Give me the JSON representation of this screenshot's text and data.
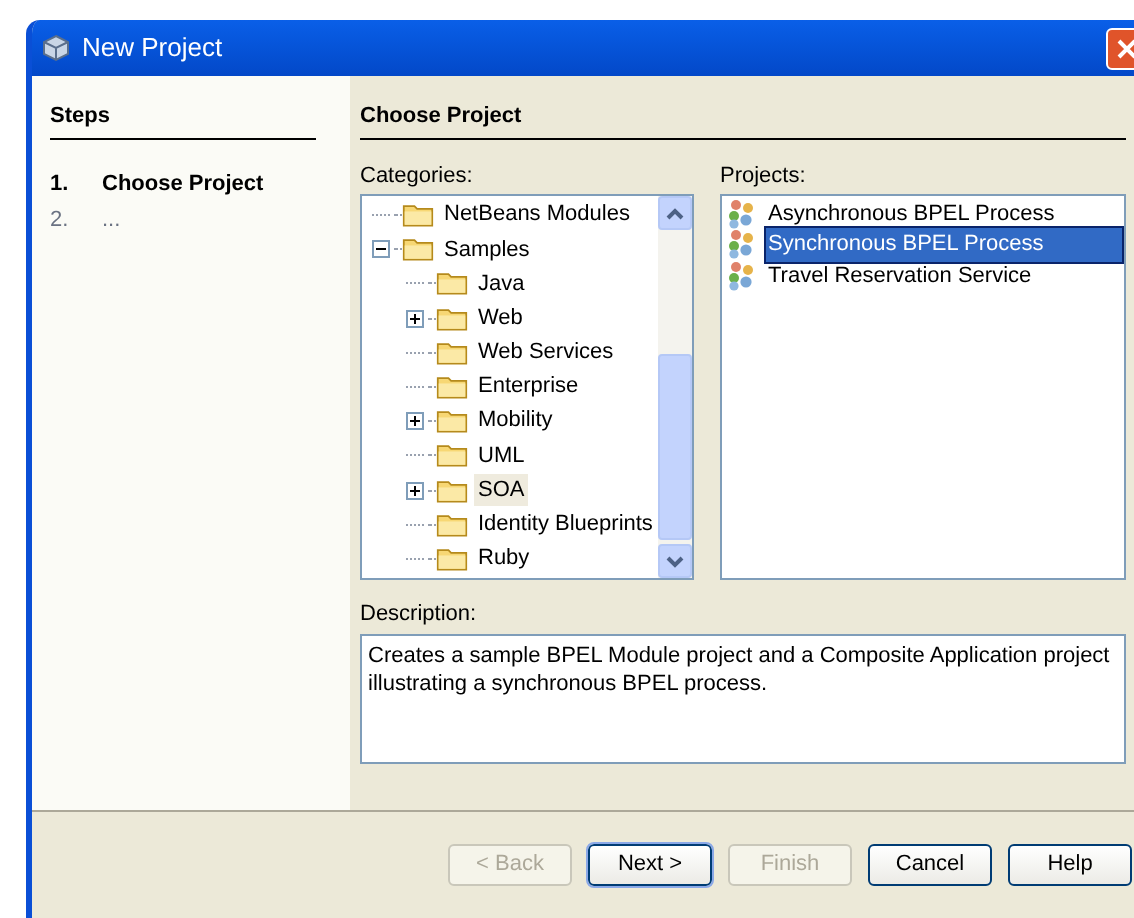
{
  "window": {
    "title": "New Project"
  },
  "steps": {
    "title": "Steps",
    "items": [
      {
        "number": "1.",
        "label": "Choose Project",
        "selected": true
      },
      {
        "number": "2.",
        "label": "...",
        "selected": false
      }
    ]
  },
  "panel": {
    "title": "Choose Project"
  },
  "categories": {
    "label": "Categories:",
    "items": [
      {
        "label": "NetBeans Modules",
        "selected": false
      },
      {
        "label": "Samples",
        "expanded": true,
        "selected": false,
        "children": [
          {
            "label": "Java",
            "selected": false
          },
          {
            "label": "Web",
            "expanded": false,
            "selected": false
          },
          {
            "label": "Web Services",
            "selected": false
          },
          {
            "label": "Enterprise",
            "selected": false
          },
          {
            "label": "Mobility",
            "expanded": false,
            "selected": false
          },
          {
            "label": "UML",
            "selected": false
          },
          {
            "label": "SOA",
            "expanded": false,
            "selected": true
          },
          {
            "label": "Identity Blueprints",
            "selected": false
          },
          {
            "label": "Ruby",
            "selected": false
          }
        ]
      }
    ]
  },
  "projects": {
    "label": "Projects:",
    "items": [
      {
        "label": "Asynchronous BPEL Process",
        "selected": false
      },
      {
        "label": "Synchronous BPEL Process",
        "selected": true
      },
      {
        "label": "Travel Reservation Service",
        "selected": false
      }
    ]
  },
  "description": {
    "label": "Description:",
    "text": "Creates a sample BPEL Module project and a Composite Application project illustrating a synchronous BPEL process."
  },
  "buttons": [
    {
      "label": "< Back",
      "disabled": true,
      "default": false
    },
    {
      "label": "Next >",
      "disabled": false,
      "default": true
    },
    {
      "label": "Finish",
      "disabled": true,
      "default": false
    },
    {
      "label": "Cancel",
      "disabled": false,
      "default": false
    },
    {
      "label": "Help",
      "disabled": false,
      "default": false
    }
  ]
}
